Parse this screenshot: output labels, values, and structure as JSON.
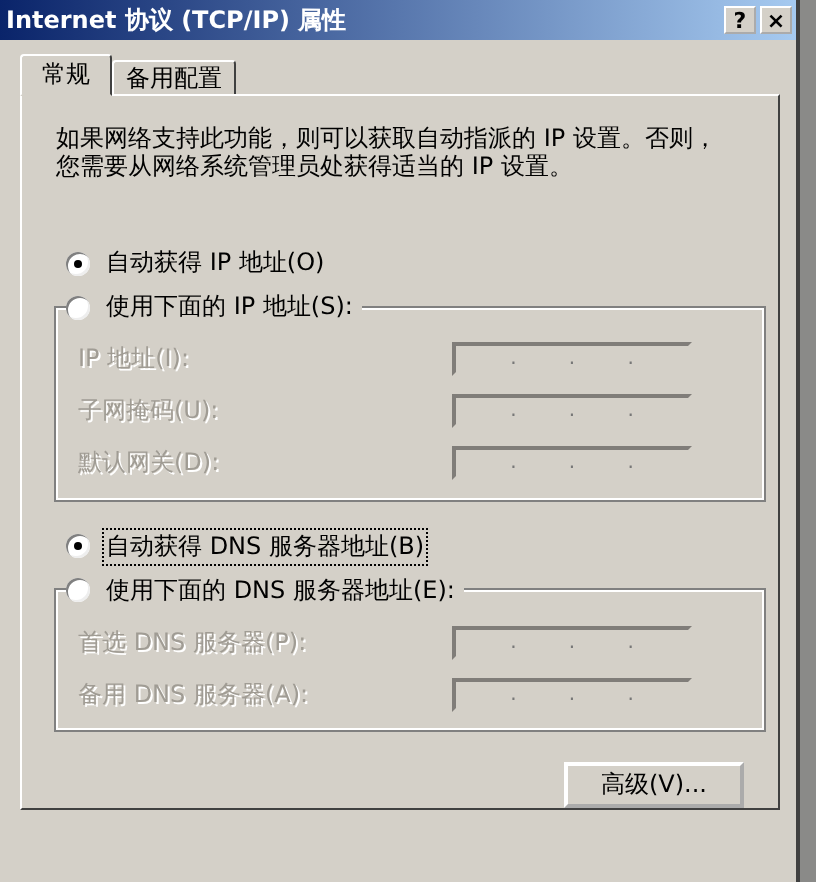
{
  "window": {
    "title": "Internet 协议 (TCP/IP) 属性",
    "help": "?",
    "close": "×"
  },
  "tabs": [
    {
      "label": "常规",
      "selected": true
    },
    {
      "label": "备用配置",
      "selected": false
    }
  ],
  "description": [
    "如果网络支持此功能，则可以获取自动指派的 IP 设置。否则，",
    "您需要从网络系统管理员处获得适当的 IP 设置。"
  ],
  "ip_section": {
    "options": [
      {
        "label": "自动获得 IP 地址(O)",
        "selected": true,
        "focused": false
      },
      {
        "label": "使用下面的 IP 地址(S):",
        "selected": false,
        "focused": false
      }
    ],
    "fields": [
      {
        "label": "IP 地址(I):",
        "disabled": true,
        "separator": "."
      },
      {
        "label": "子网掩码(U):",
        "disabled": true,
        "separator": "."
      },
      {
        "label": "默认网关(D):",
        "disabled": true,
        "separator": "."
      }
    ]
  },
  "dns_section": {
    "options": [
      {
        "label": "自动获得 DNS 服务器地址(B)",
        "selected": true,
        "focused": true
      },
      {
        "label": "使用下面的 DNS 服务器地址(E):",
        "selected": false,
        "focused": false
      }
    ],
    "fields": [
      {
        "label": "首选 DNS 服务器(P):",
        "disabled": true,
        "separator": "."
      },
      {
        "label": "备用 DNS 服务器(A):",
        "disabled": true,
        "separator": "."
      }
    ]
  },
  "advanced_button": "高级(V)..."
}
